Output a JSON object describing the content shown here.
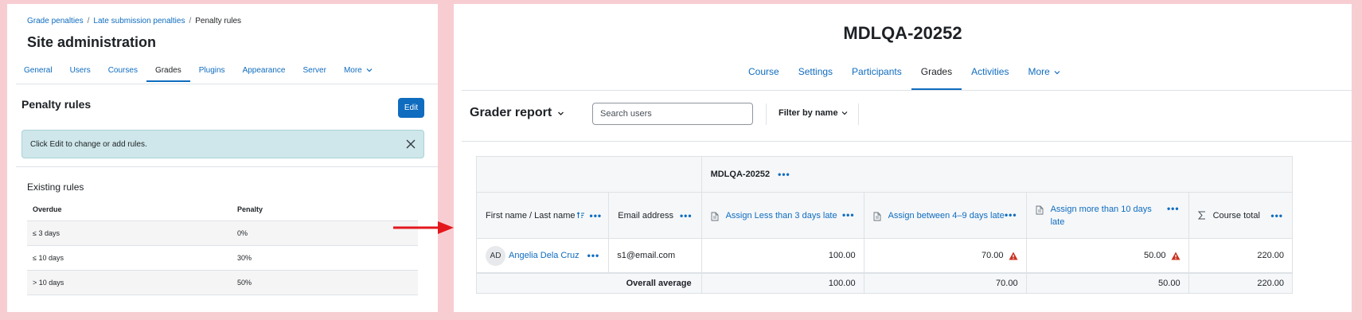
{
  "left": {
    "breadcrumb": [
      "Grade penalties",
      "Late submission penalties",
      "Penalty rules"
    ],
    "site_title": "Site administration",
    "nav": [
      "General",
      "Users",
      "Courses",
      "Grades",
      "Plugins",
      "Appearance",
      "Server",
      "More"
    ],
    "nav_active": "Grades",
    "section_title": "Penalty rules",
    "edit_label": "Edit",
    "alert_text": "Click Edit to change or add rules.",
    "existing_title": "Existing rules",
    "table": {
      "headers": [
        "Overdue",
        "Penalty"
      ],
      "rows": [
        [
          "≤ 3 days",
          "0%"
        ],
        [
          "≤ 10 days",
          "30%"
        ],
        [
          "> 10 days",
          "50%"
        ]
      ]
    }
  },
  "right": {
    "course_title": "MDLQA-20252",
    "nav": [
      "Course",
      "Settings",
      "Participants",
      "Grades",
      "Activities",
      "More"
    ],
    "nav_active": "Grades",
    "report_title": "Grader report",
    "search_placeholder": "Search users",
    "filter_label": "Filter by name",
    "category_header": "MDLQA-20252",
    "columns": {
      "name": "First name / Last name",
      "email": "Email address",
      "assign1": "Assign Less than 3 days late",
      "assign2": "Assign between 4–9 days late",
      "assign3": "Assign more than 10 days late",
      "total": "Course total"
    },
    "student": {
      "initials": "AD",
      "name": "Angelia Dela Cruz",
      "email": "s1@email.com",
      "grades": [
        "100.00",
        "70.00",
        "50.00",
        "220.00"
      ]
    },
    "average": {
      "label": "Overall average",
      "values": [
        "100.00",
        "70.00",
        "50.00",
        "220.00"
      ]
    },
    "dots": "•••"
  },
  "colors": {
    "accent": "#0f6cbf",
    "background": "#f7cdd2",
    "arrow": "#e3181d",
    "warning": "#ca3120"
  }
}
